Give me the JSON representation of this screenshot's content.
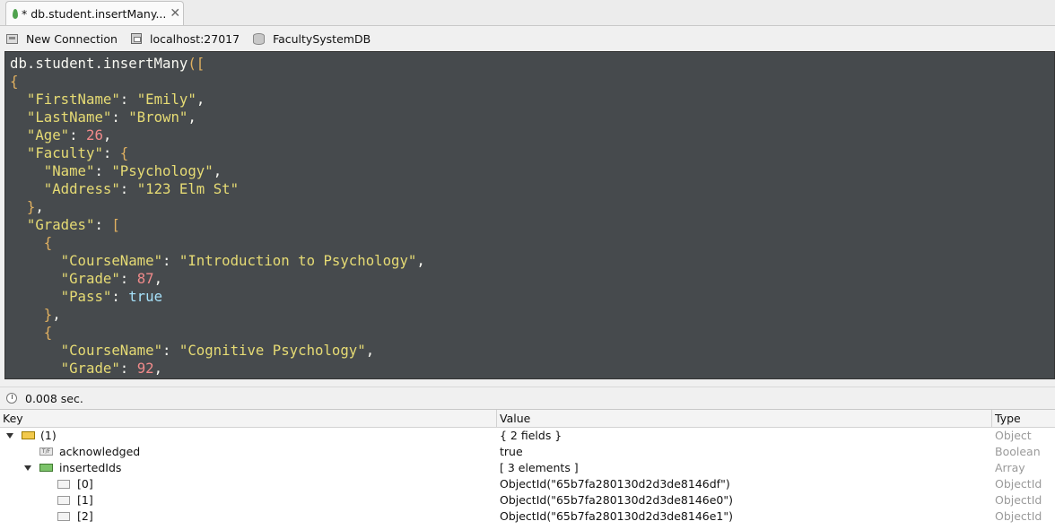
{
  "tab": {
    "title": "* db.student.insertMany...",
    "close": "✕"
  },
  "connection": {
    "name": "New Connection",
    "server": "localhost:27017",
    "database": "FacultySystemDB"
  },
  "editor": {
    "lines": [
      [
        [
          "plain",
          "db.student.insertMany"
        ],
        [
          "brk",
          "(["
        ]
      ],
      [
        [
          "brk",
          "{"
        ]
      ],
      [
        [
          "plain",
          "  "
        ],
        [
          "str",
          "\"FirstName\""
        ],
        [
          "plain",
          ": "
        ],
        [
          "str",
          "\"Emily\""
        ],
        [
          "plain",
          ","
        ]
      ],
      [
        [
          "plain",
          "  "
        ],
        [
          "str",
          "\"LastName\""
        ],
        [
          "plain",
          ": "
        ],
        [
          "str",
          "\"Brown\""
        ],
        [
          "plain",
          ","
        ]
      ],
      [
        [
          "plain",
          "  "
        ],
        [
          "str",
          "\"Age\""
        ],
        [
          "plain",
          ": "
        ],
        [
          "num",
          "26"
        ],
        [
          "plain",
          ","
        ]
      ],
      [
        [
          "plain",
          "  "
        ],
        [
          "str",
          "\"Faculty\""
        ],
        [
          "plain",
          ": "
        ],
        [
          "brk",
          "{"
        ]
      ],
      [
        [
          "plain",
          "    "
        ],
        [
          "str",
          "\"Name\""
        ],
        [
          "plain",
          ": "
        ],
        [
          "str",
          "\"Psychology\""
        ],
        [
          "plain",
          ","
        ]
      ],
      [
        [
          "plain",
          "    "
        ],
        [
          "str",
          "\"Address\""
        ],
        [
          "plain",
          ": "
        ],
        [
          "str",
          "\"123 Elm St\""
        ]
      ],
      [
        [
          "plain",
          "  "
        ],
        [
          "brk",
          "}"
        ],
        [
          "plain",
          ","
        ]
      ],
      [
        [
          "plain",
          "  "
        ],
        [
          "str",
          "\"Grades\""
        ],
        [
          "plain",
          ": "
        ],
        [
          "brk",
          "["
        ]
      ],
      [
        [
          "plain",
          "    "
        ],
        [
          "brk",
          "{"
        ]
      ],
      [
        [
          "plain",
          "      "
        ],
        [
          "str",
          "\"CourseName\""
        ],
        [
          "plain",
          ": "
        ],
        [
          "str",
          "\"Introduction to Psychology\""
        ],
        [
          "plain",
          ","
        ]
      ],
      [
        [
          "plain",
          "      "
        ],
        [
          "str",
          "\"Grade\""
        ],
        [
          "plain",
          ": "
        ],
        [
          "num",
          "87"
        ],
        [
          "plain",
          ","
        ]
      ],
      [
        [
          "plain",
          "      "
        ],
        [
          "str",
          "\"Pass\""
        ],
        [
          "plain",
          ": "
        ],
        [
          "bool",
          "true"
        ]
      ],
      [
        [
          "plain",
          "    "
        ],
        [
          "brk",
          "}"
        ],
        [
          "plain",
          ","
        ]
      ],
      [
        [
          "plain",
          "    "
        ],
        [
          "brk",
          "{"
        ]
      ],
      [
        [
          "plain",
          "      "
        ],
        [
          "str",
          "\"CourseName\""
        ],
        [
          "plain",
          ": "
        ],
        [
          "str",
          "\"Cognitive Psychology\""
        ],
        [
          "plain",
          ","
        ]
      ],
      [
        [
          "plain",
          "      "
        ],
        [
          "str",
          "\"Grade\""
        ],
        [
          "plain",
          ": "
        ],
        [
          "num",
          "92"
        ],
        [
          "plain",
          ","
        ]
      ]
    ]
  },
  "status": {
    "time": "0.008 sec."
  },
  "results": {
    "columns": {
      "key": "Key",
      "value": "Value",
      "type": "Type"
    },
    "rows": [
      {
        "key": "(1)",
        "value": "{ 2 fields }",
        "type": "Object"
      },
      {
        "key": "acknowledged",
        "value": "true",
        "type": "Boolean"
      },
      {
        "key": "insertedIds",
        "value": "[ 3 elements ]",
        "type": "Array"
      },
      {
        "key": "[0]",
        "value": "ObjectId(\"65b7fa280130d2d3de8146df\")",
        "type": "ObjectId"
      },
      {
        "key": "[1]",
        "value": "ObjectId(\"65b7fa280130d2d3de8146e0\")",
        "type": "ObjectId"
      },
      {
        "key": "[2]",
        "value": "ObjectId(\"65b7fa280130d2d3de8146e1\")",
        "type": "ObjectId"
      }
    ]
  }
}
